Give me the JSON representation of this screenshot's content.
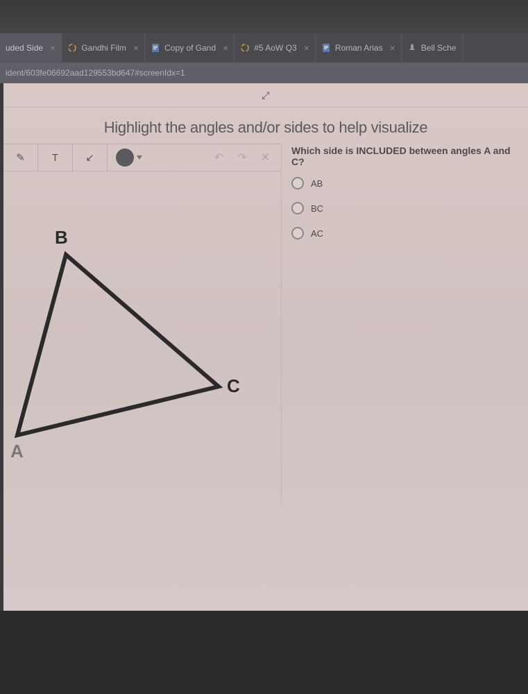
{
  "browser": {
    "tabs": [
      {
        "label": "uded Side"
      },
      {
        "label": "Gandhi Film"
      },
      {
        "label": "Copy of Gand"
      },
      {
        "label": "#5 AoW Q3"
      },
      {
        "label": "Roman Arias"
      },
      {
        "label": "Bell Sche"
      }
    ],
    "url": "ident/603fe06692aad129553bd647#screenIdx=1"
  },
  "page": {
    "heading": "Highlight the angles and/or sides to help visualize",
    "toolbar": {
      "pen": "✎",
      "text": "T",
      "line": "↙"
    },
    "triangle": {
      "labelB": "B",
      "labelC": "C",
      "labelA": "A"
    },
    "question": "Which side is INCLUDED between angles A and C?",
    "options": [
      {
        "label": "AB"
      },
      {
        "label": "BC"
      },
      {
        "label": "AC"
      }
    ]
  }
}
